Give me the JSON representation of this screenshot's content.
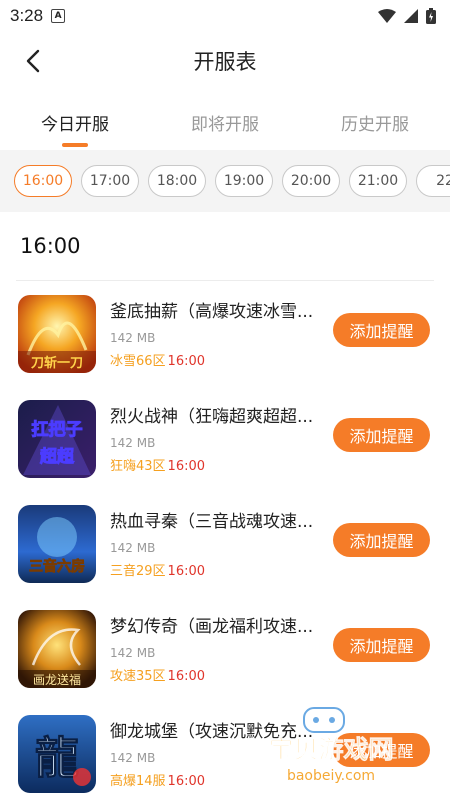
{
  "status_bar": {
    "time": "3:28",
    "a_badge": "A"
  },
  "nav": {
    "title": "开服表"
  },
  "tabs": [
    {
      "label": "今日开服",
      "active": true
    },
    {
      "label": "即将开服",
      "active": false
    },
    {
      "label": "历史开服",
      "active": false
    }
  ],
  "time_slots": [
    "16:00",
    "17:00",
    "18:00",
    "19:00",
    "20:00",
    "21:00",
    "22"
  ],
  "selected_slot": "16:00",
  "section": {
    "title": "16:00"
  },
  "games": [
    {
      "name": "釜底抽薪（高爆攻速冰雪...",
      "size": "142 MB",
      "zone": "冰雪66区",
      "time": "16:00",
      "button": "添加提醒",
      "icon": "game-icon-fire"
    },
    {
      "name": "烈火战神（狂嗨超爽超超...",
      "size": "142 MB",
      "zone": "狂嗨43区",
      "time": "16:00",
      "button": "添加提醒",
      "icon": "game-icon-warrior"
    },
    {
      "name": "热血寻秦（三音战魂攻速...",
      "size": "142 MB",
      "zone": "三音29区",
      "time": "16:00",
      "button": "添加提醒",
      "icon": "game-icon-qin"
    },
    {
      "name": "梦幻传奇（画龙福利攻速...",
      "size": "142 MB",
      "zone": "攻速35区",
      "time": "16:00",
      "button": "添加提醒",
      "icon": "game-icon-dragon"
    },
    {
      "name": "御龙城堡（攻速沉默免充...",
      "size": "142 MB",
      "zone": "高爆14服",
      "time": "16:00",
      "button": "添加提醒",
      "icon": "game-icon-castle"
    }
  ],
  "watermark": {
    "brand": "宝贝游戏网",
    "url": "baobeiy.com"
  },
  "colors": {
    "accent": "#f57c28",
    "zone": "#f5a020",
    "time": "#e0352b"
  }
}
